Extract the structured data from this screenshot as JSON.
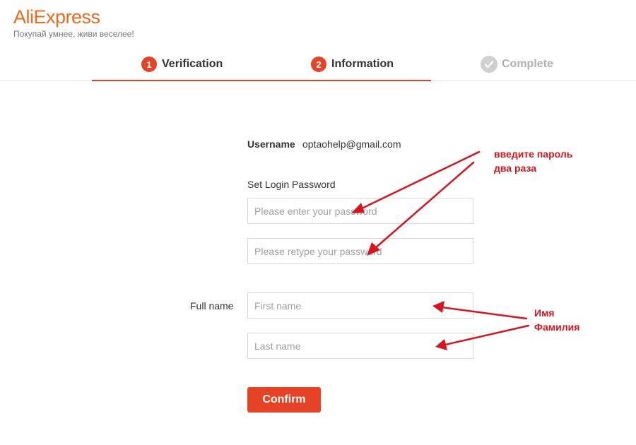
{
  "brand": {
    "logo": "AliExpress",
    "tagline": "Покупай умнее, живи веселее!",
    "accent_color": "#e64326",
    "logo_color": "#ef6a1a"
  },
  "steps": [
    {
      "number": "1",
      "label": "Verification",
      "state": "done"
    },
    {
      "number": "2",
      "label": "Information",
      "state": "active"
    },
    {
      "number": "",
      "label": "Complete",
      "state": "pending",
      "icon": "check-icon"
    }
  ],
  "form": {
    "username_label": "Username",
    "username_value": "optaohelp@gmail.com",
    "password_label": "Set Login Password",
    "password_placeholder": "Please enter your password",
    "retype_placeholder": "Please retype your password",
    "fullname_label": "Full name",
    "first_name_placeholder": "First name",
    "last_name_placeholder": "Last name",
    "confirm_label": "Confirm"
  },
  "annotations": {
    "password_note_line1": "введите пароль",
    "password_note_line2": "два раза",
    "name_note_line1": "Имя",
    "name_note_line2": "Фамилия",
    "color": "#d9141f"
  }
}
